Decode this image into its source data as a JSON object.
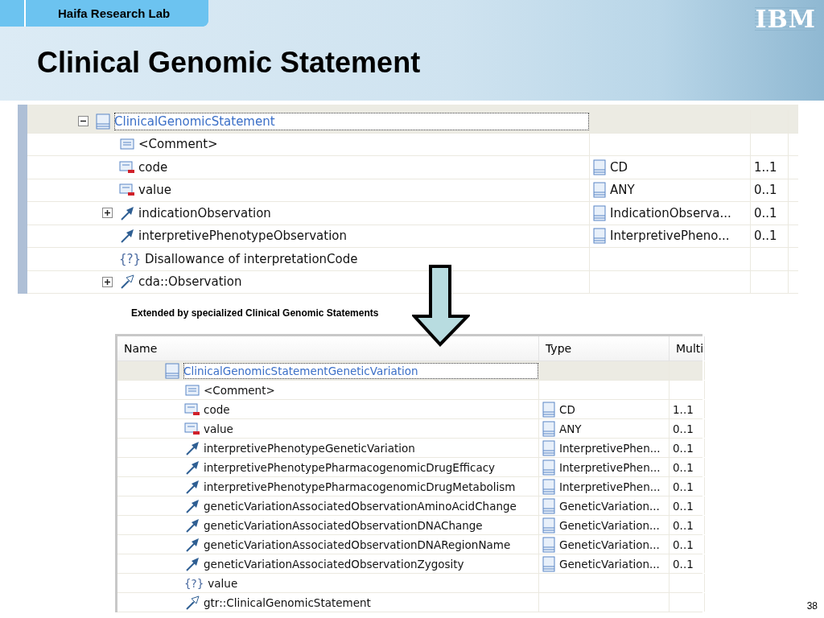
{
  "header": {
    "tag": "Haifa Research Lab",
    "title": "Clinical Genomic Statement",
    "logo": "IBM"
  },
  "top_tree": {
    "rows": [
      {
        "kind": "class",
        "name": "ClinicalGenomicStatement",
        "selected": true,
        "expanded": true,
        "children": [
          {
            "kind": "comment",
            "name": "<Comment>",
            "selected": false
          },
          {
            "kind": "attribute",
            "name": "code",
            "type": "CD",
            "multiplicity": "1..1",
            "selected": false
          },
          {
            "kind": "attribute",
            "name": "value",
            "type": "ANY",
            "multiplicity": "0..1",
            "selected": false
          },
          {
            "kind": "association",
            "name": "indicationObservation",
            "type": "IndicationObserva...",
            "multiplicity": "0..1",
            "selected": false,
            "expanded": false
          },
          {
            "kind": "association",
            "name": "interpretivePhenotypeObservation",
            "type": "InterpretivePheno...",
            "multiplicity": "0..1",
            "selected": false
          },
          {
            "kind": "constraint",
            "marker": "{?}",
            "name": "Disallowance of interpretationCode",
            "selected": false
          },
          {
            "kind": "generalization",
            "name": "cda::Observation",
            "selected": false,
            "expanded": false
          }
        ]
      }
    ]
  },
  "caption": "Extended by specialized Clinical Genomic Statements",
  "bottom_tree": {
    "columns": [
      "Name",
      "Type",
      "Multi"
    ],
    "rows": [
      {
        "kind": "class",
        "name": "ClinicalGenomicStatementGeneticVariation",
        "selected": true,
        "children": [
          {
            "kind": "comment",
            "name": "<Comment>",
            "selected": false
          },
          {
            "kind": "attribute",
            "name": "code",
            "type": "CD",
            "multiplicity": "1..1",
            "selected": false
          },
          {
            "kind": "attribute",
            "name": "value",
            "type": "ANY",
            "multiplicity": "0..1",
            "selected": false
          },
          {
            "kind": "association",
            "name": "interpretivePhenotypeGeneticVariation",
            "type": "InterpretivePhen...",
            "multiplicity": "0..1",
            "selected": false
          },
          {
            "kind": "association",
            "name": "interpretivePhenotypePharmacogenomicDrugEfficacy",
            "type": "InterpretivePhen...",
            "multiplicity": "0..1",
            "selected": false
          },
          {
            "kind": "association",
            "name": "interpretivePhenotypePharmacogenomicDrugMetabolism",
            "type": "InterpretivePhen...",
            "multiplicity": "0..1",
            "selected": false
          },
          {
            "kind": "association",
            "name": "geneticVariationAssociatedObservationAminoAcidChange",
            "type": "GeneticVariation...",
            "multiplicity": "0..1",
            "selected": false
          },
          {
            "kind": "association",
            "name": "geneticVariationAssociatedObservationDNAChange",
            "type": "GeneticVariation...",
            "multiplicity": "0..1",
            "selected": false
          },
          {
            "kind": "association",
            "name": "geneticVariationAssociatedObservationDNARegionName",
            "type": "GeneticVariation...",
            "multiplicity": "0..1",
            "selected": false
          },
          {
            "kind": "association",
            "name": "geneticVariationAssociatedObservationZygosity",
            "type": "GeneticVariation...",
            "multiplicity": "0..1",
            "selected": false
          },
          {
            "kind": "constraint",
            "marker": "{?}",
            "name": "value",
            "selected": false
          },
          {
            "kind": "generalization",
            "name": "gtr::ClinicalGenomicStatement",
            "selected": false
          }
        ]
      }
    ]
  },
  "page_number": "38"
}
